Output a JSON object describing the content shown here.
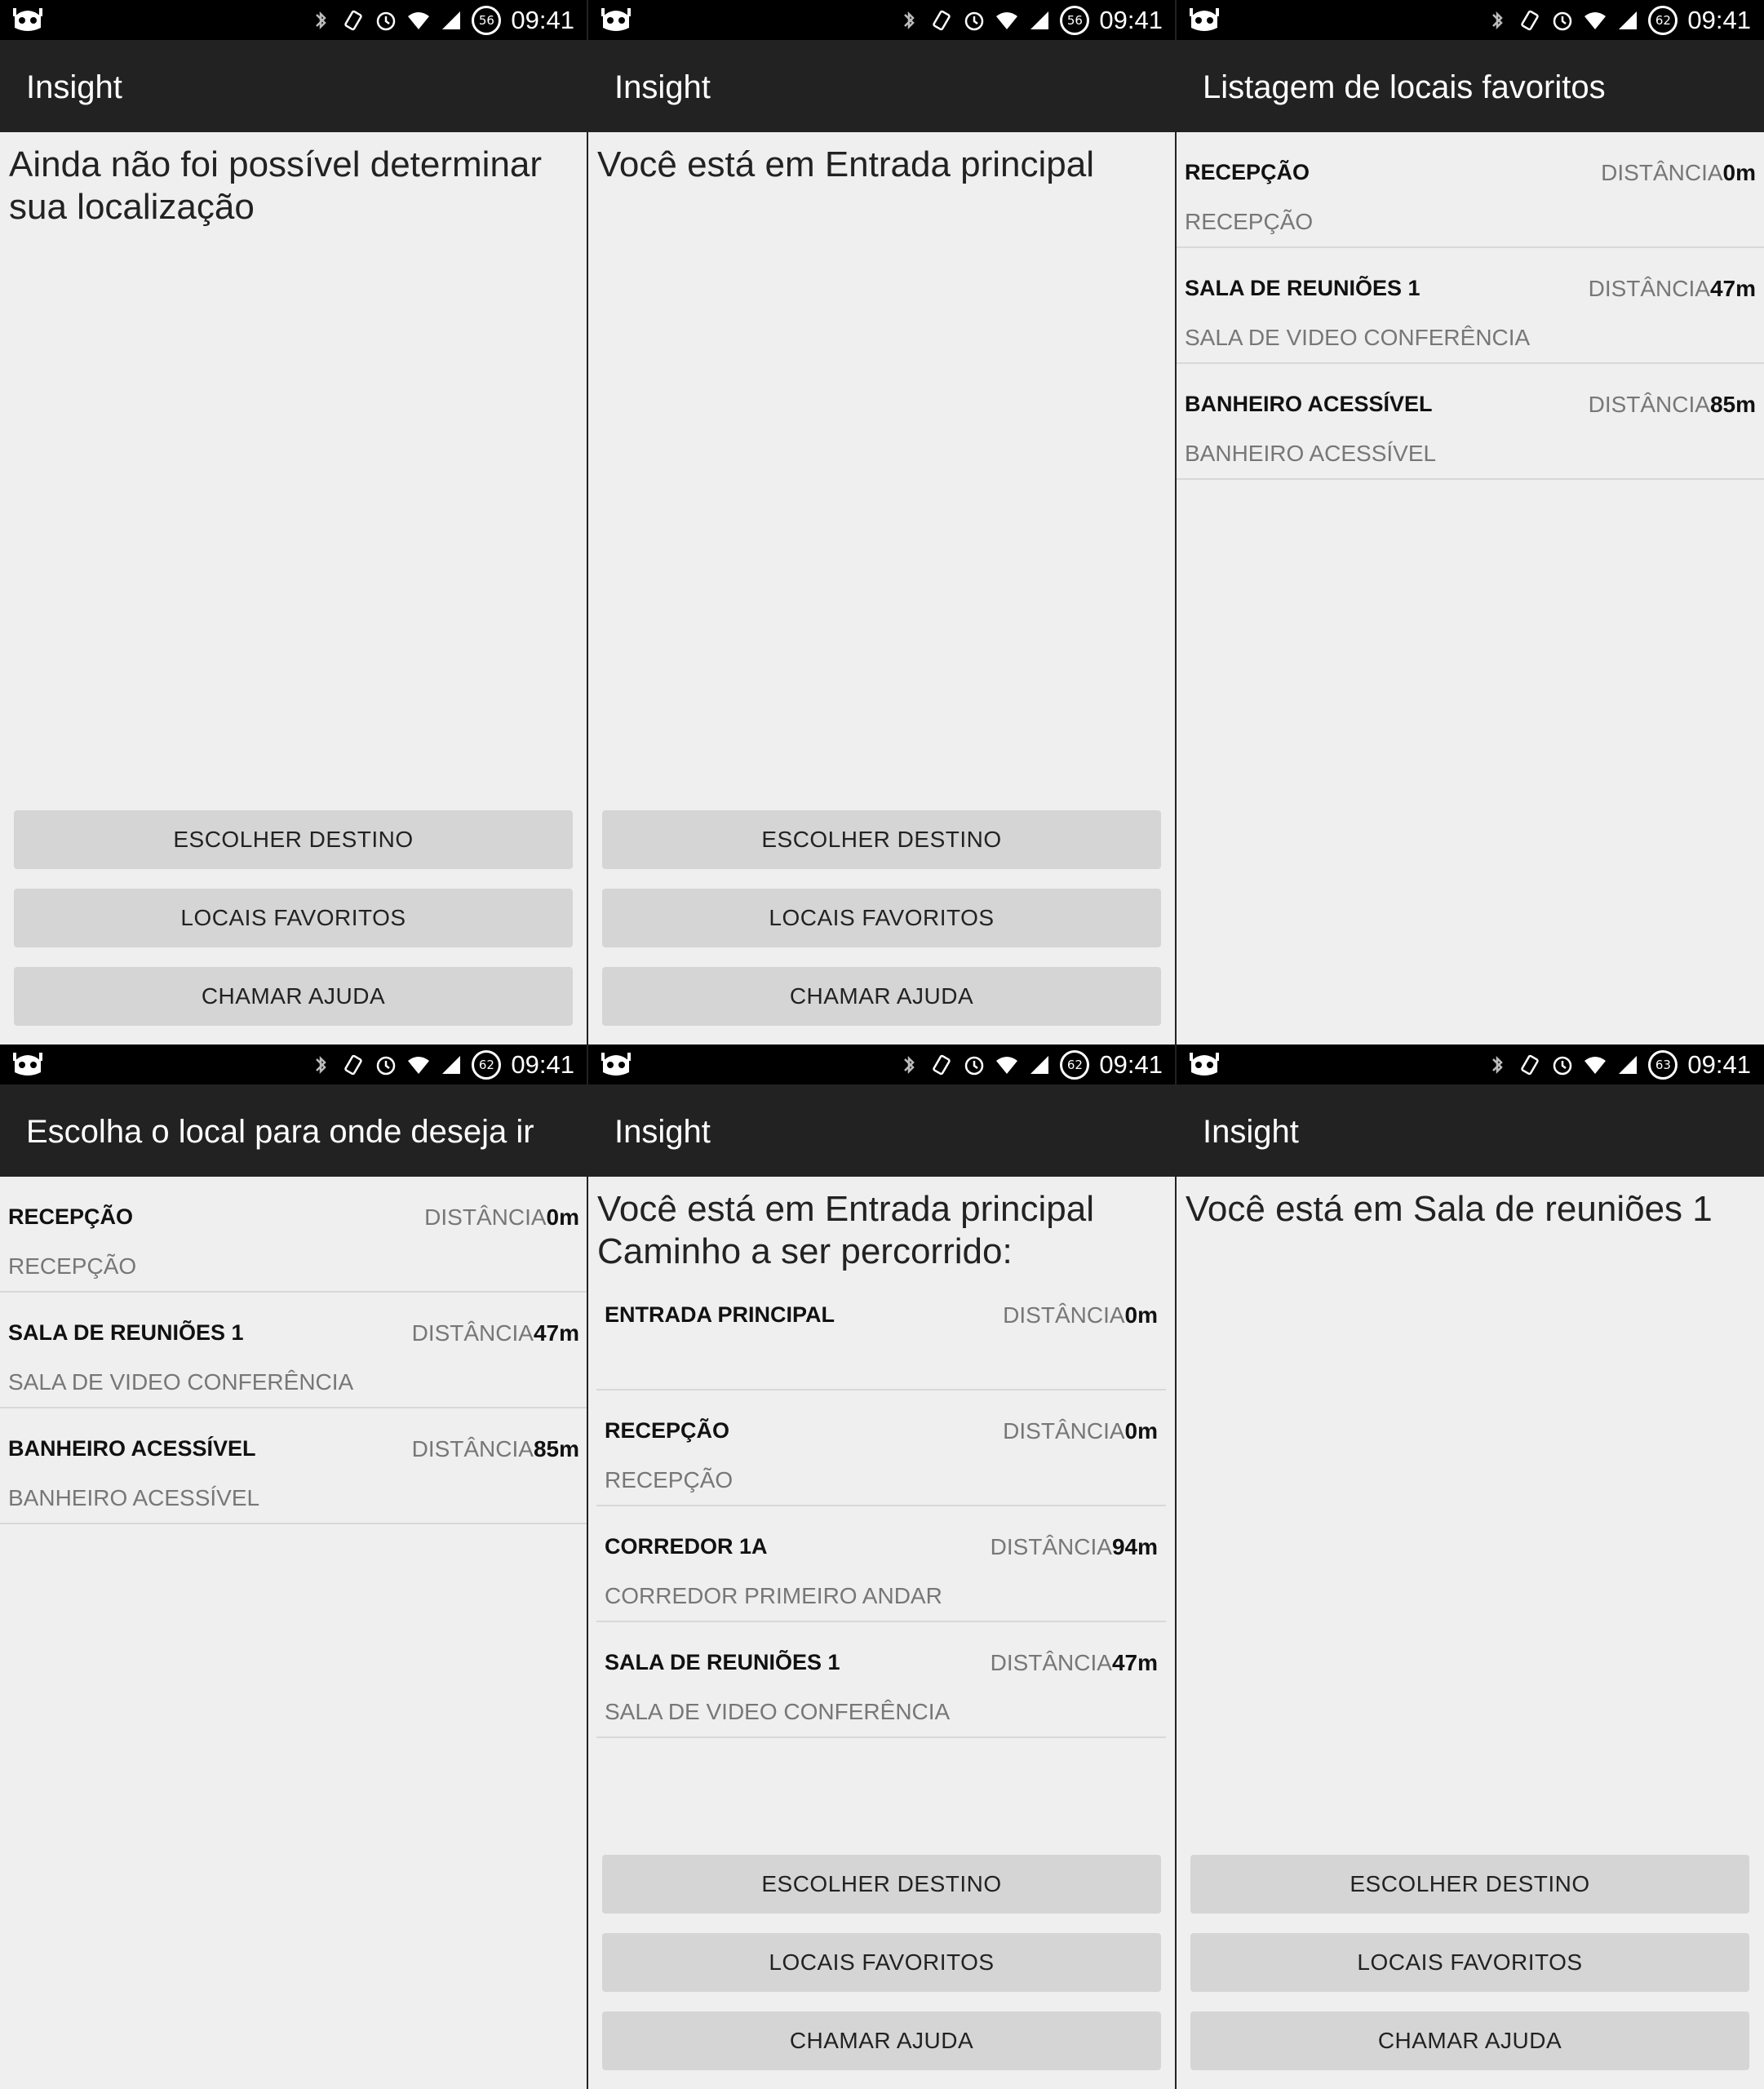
{
  "status_bar": {
    "time": "09:41",
    "battery_levels": [
      "56",
      "56",
      "62",
      "62",
      "62",
      "63"
    ]
  },
  "buttons": {
    "choose_destination": "ESCOLHER DESTINO",
    "favorites": "LOCAIS FAVORITOS",
    "call_help": "CHAMAR AJUDA"
  },
  "distance_label": "DISTÂNCIA",
  "screens": [
    {
      "title": "Insight",
      "message": "Ainda não foi possível determinar sua localização"
    },
    {
      "title": "Insight",
      "message": "Você está em Entrada principal"
    },
    {
      "title": "Listagem de locais favoritos",
      "items": [
        {
          "name": "RECEPÇÃO",
          "subtitle": "RECEPÇÃO",
          "distance": "0m"
        },
        {
          "name": "SALA DE REUNIÕES 1",
          "subtitle": "SALA DE VIDEO CONFERÊNCIA",
          "distance": "47m"
        },
        {
          "name": "BANHEIRO ACESSÍVEL",
          "subtitle": "BANHEIRO ACESSÍVEL",
          "distance": "85m"
        }
      ]
    },
    {
      "title": "Escolha o local para onde deseja ir",
      "items": [
        {
          "name": "RECEPÇÃO",
          "subtitle": "RECEPÇÃO",
          "distance": "0m"
        },
        {
          "name": "SALA DE REUNIÕES 1",
          "subtitle": "SALA DE VIDEO CONFERÊNCIA",
          "distance": "47m"
        },
        {
          "name": "BANHEIRO ACESSÍVEL",
          "subtitle": "BANHEIRO ACESSÍVEL",
          "distance": "85m"
        }
      ]
    },
    {
      "title": "Insight",
      "message_line1": "Você está em Entrada principal",
      "message_line2": "Caminho a ser percorrido:",
      "items": [
        {
          "name": "ENTRADA PRINCIPAL",
          "subtitle": "",
          "distance": "0m"
        },
        {
          "name": "RECEPÇÃO",
          "subtitle": "RECEPÇÃO",
          "distance": "0m"
        },
        {
          "name": "CORREDOR 1A",
          "subtitle": "CORREDOR PRIMEIRO ANDAR",
          "distance": "94m"
        },
        {
          "name": "SALA DE REUNIÕES 1",
          "subtitle": "SALA DE VIDEO CONFERÊNCIA",
          "distance": "47m"
        }
      ]
    },
    {
      "title": "Insight",
      "message": "Você está em Sala de reuniões 1"
    }
  ]
}
